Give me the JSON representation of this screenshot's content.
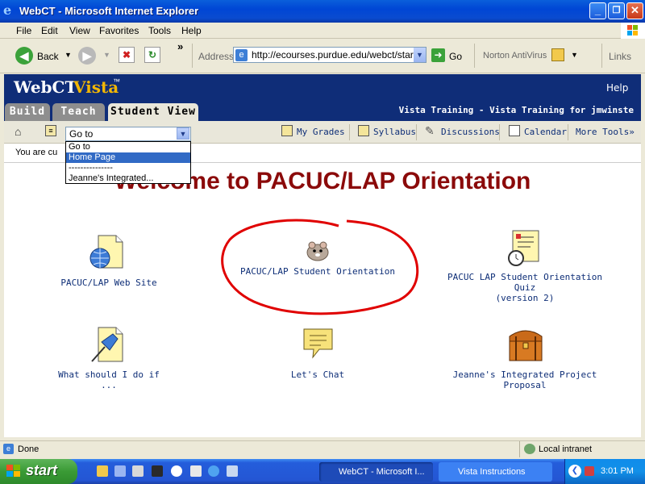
{
  "window": {
    "title": "WebCT - Microsoft Internet Explorer",
    "controls": [
      "_",
      "❐",
      "✕"
    ]
  },
  "menu": [
    "File",
    "Edit",
    "View",
    "Favorites",
    "Tools",
    "Help"
  ],
  "toolbar": {
    "back_label": "Back",
    "address_label": "Address",
    "address_value": "http://ecourses.purdue.edu/webct/startf",
    "go_label": "Go",
    "norton_label": "Norton AntiVirus",
    "links_label": "Links",
    "chevron": "»"
  },
  "webct": {
    "logo_main": "WebCT",
    "logo_vista": "Vista",
    "logo_tm": "™",
    "help_label": "Help",
    "tabs": [
      "Build",
      "Teach",
      "Student View"
    ],
    "context_title": "Vista Training - Vista Training for jmwinste"
  },
  "tools": {
    "goto_value": "Go to",
    "goto_options": [
      "Go to",
      "Home Page",
      "---------------",
      "Jeanne's Integrated..."
    ],
    "links": [
      "My Grades",
      "Syllabus",
      "Discussions",
      "Calendar",
      "More Tools»"
    ]
  },
  "crumb": {
    "text": "You are cu"
  },
  "content": {
    "welcome": "Welcome to PACUC/LAP Orientation",
    "items": [
      {
        "label": "PACUC/LAP Web Site",
        "icon": "globe-page-icon"
      },
      {
        "label": "PACUC/LAP Student Orientation",
        "icon": "hamster-icon"
      },
      {
        "label": "PACUC LAP Student Orientation Quiz\n(version 2)",
        "icon": "quiz-clock-icon"
      },
      {
        "label": "What should I do if ...",
        "icon": "pushpin-note-icon"
      },
      {
        "label": "Let's Chat",
        "icon": "chat-bubble-icon"
      },
      {
        "label": "Jeanne's Integrated Project Proposal",
        "icon": "treasure-chest-icon"
      }
    ],
    "highlight_color": "#E00000"
  },
  "status": {
    "text": "Done",
    "zone": "Local intranet"
  },
  "taskbar": {
    "start": "start",
    "items": [
      "WebCT - Microsoft I...",
      "Vista Instructions"
    ],
    "time": "3:01 PM"
  },
  "colors": {
    "webct_navy": "#0F2D78",
    "title_red": "#8B0A0A",
    "link_blue": "#0E2E77"
  }
}
